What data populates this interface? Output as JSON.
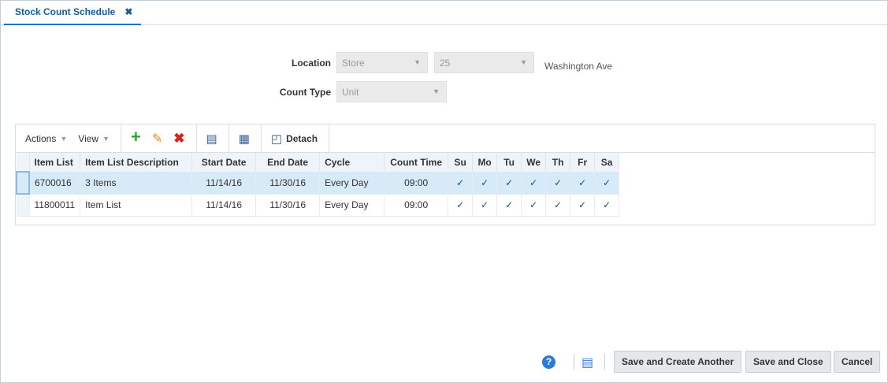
{
  "tab": {
    "title": "Stock Count Schedule",
    "close": "✖"
  },
  "form": {
    "location_label": "Location",
    "location_type": "Store",
    "location_id": "25",
    "location_name": "Washington Ave",
    "count_type_label": "Count Type",
    "count_type": "Unit"
  },
  "toolbar": {
    "actions": "Actions",
    "view": "View",
    "detach": "Detach"
  },
  "table": {
    "columns": [
      "Item List",
      "Item List Description",
      "Start Date",
      "End Date",
      "Cycle",
      "Count Time",
      "Su",
      "Mo",
      "Tu",
      "We",
      "Th",
      "Fr",
      "Sa"
    ],
    "rows": [
      {
        "cells": [
          "6700016",
          "3 Items",
          "11/14/16",
          "11/30/16",
          "Every Day",
          "09:00",
          "✓",
          "✓",
          "✓",
          "✓",
          "✓",
          "✓",
          "✓"
        ]
      },
      {
        "cells": [
          "11800011",
          "Item List",
          "11/14/16",
          "11/30/16",
          "Every Day",
          "09:00",
          "✓",
          "✓",
          "✓",
          "✓",
          "✓",
          "✓",
          "✓"
        ]
      }
    ]
  },
  "footer": {
    "help": "?",
    "save_create": "Save and Create Another",
    "save_close": "Save and Close",
    "cancel": "Cancel"
  }
}
